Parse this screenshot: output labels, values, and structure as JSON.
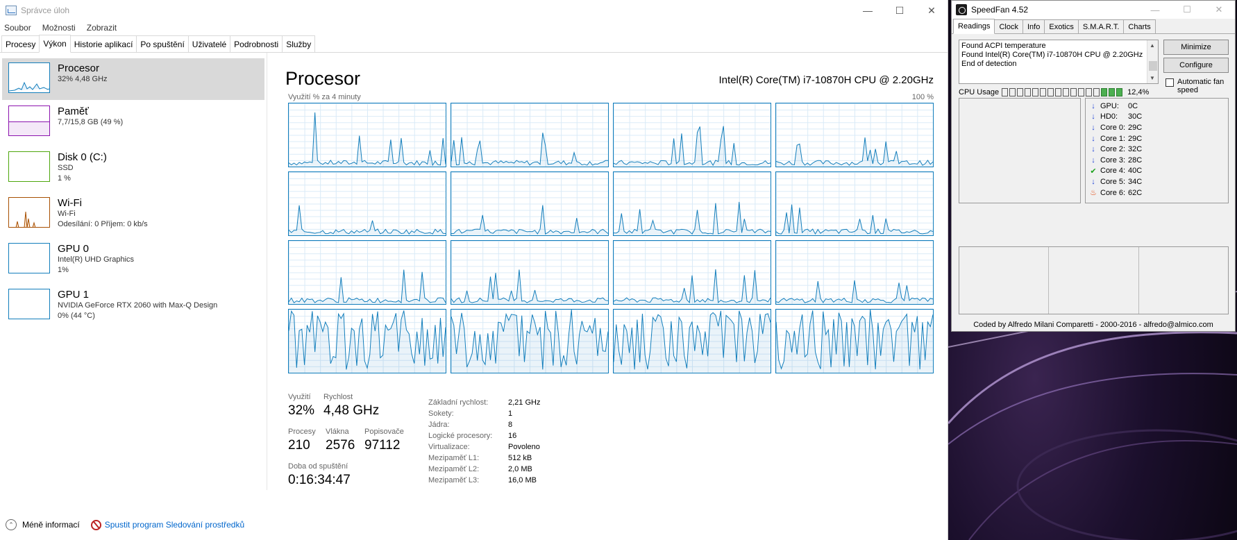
{
  "taskmanager": {
    "title": "Správce úloh",
    "menu": [
      "Soubor",
      "Možnosti",
      "Zobrazit"
    ],
    "tabs": [
      "Procesy",
      "Výkon",
      "Historie aplikací",
      "Po spuštění",
      "Uživatelé",
      "Podrobnosti",
      "Služby"
    ],
    "active_tab": "Výkon",
    "sidebar": [
      {
        "name": "Procesor",
        "sub1": "32%  4,48 GHz",
        "sub2": "",
        "sub3": "",
        "color": "#117dbb"
      },
      {
        "name": "Paměť",
        "sub1": "7,7/15,8 GB (49 %)",
        "sub2": "",
        "sub3": "",
        "color": "#8b12ae"
      },
      {
        "name": "Disk 0 (C:)",
        "sub1": "SSD",
        "sub2": "1 %",
        "sub3": "",
        "color": "#4da60c"
      },
      {
        "name": "Wi-Fi",
        "sub1": "Wi-Fi",
        "sub2": "Odesílání: 0  Příjem: 0 kb/s",
        "sub3": "",
        "color": "#a74f01"
      },
      {
        "name": "GPU 0",
        "sub1": "Intel(R) UHD Graphics",
        "sub2": "1%",
        "sub3": "",
        "color": "#117dbb"
      },
      {
        "name": "GPU 1",
        "sub1": "NVIDIA GeForce RTX 2060 with Max-Q Design",
        "sub2": "0%  (44 °C)",
        "sub3": "",
        "color": "#117dbb"
      }
    ],
    "main": {
      "title": "Procesor",
      "model": "Intel(R) Core(TM) i7-10870H CPU @ 2.20GHz",
      "util_label": "Využití % za 4 minuty",
      "util_max": "100 %",
      "stats": {
        "util_label": "Využití",
        "util_value": "32%",
        "speed_label": "Rychlost",
        "speed_value": "4,48 GHz",
        "proc_label": "Procesy",
        "proc_value": "210",
        "threads_label": "Vlákna",
        "threads_value": "2576",
        "handles_label": "Popisovače",
        "handles_value": "97112",
        "uptime_label": "Doba od spuštění",
        "uptime_value": "0:16:34:47"
      },
      "specs": [
        {
          "k": "Základní rychlost:",
          "v": "2,21 GHz"
        },
        {
          "k": "Sokety:",
          "v": "1"
        },
        {
          "k": "Jádra:",
          "v": "8"
        },
        {
          "k": "Logické procesory:",
          "v": "16"
        },
        {
          "k": "Virtualizace:",
          "v": "Povoleno"
        },
        {
          "k": "Mezipaměť L1:",
          "v": "512 kB"
        },
        {
          "k": "Mezipaměť L2:",
          "v": "2,0 MB"
        },
        {
          "k": "Mezipaměť L3:",
          "v": "16,0 MB"
        }
      ]
    },
    "footer": {
      "fewer": "Méně informací",
      "monitor_link": "Spustit program Sledování prostředků"
    },
    "accent_color": "#117dbb"
  },
  "speedfan": {
    "title": "SpeedFan 4.52",
    "tabs": [
      "Readings",
      "Clock",
      "Info",
      "Exotics",
      "S.M.A.R.T.",
      "Charts"
    ],
    "active_tab": "Readings",
    "log": [
      "Found ACPI temperature",
      "Found Intel(R) Core(TM) i7-10870H CPU @ 2.20GHz",
      "End of detection"
    ],
    "minimize_label": "Minimize",
    "configure_label": "Configure",
    "auto_fan_label": "Automatic fan speed",
    "cpu_usage_label": "CPU Usage",
    "cpu_usage_value": "12,4%",
    "cpu_bars_on": [
      13,
      14,
      15
    ],
    "cpu_bar_count": 16,
    "temps": [
      {
        "label": "GPU:",
        "value": "0C",
        "status": "down"
      },
      {
        "label": "HD0:",
        "value": "30C",
        "status": "down"
      },
      {
        "label": "Core 0:",
        "value": "29C",
        "status": "down"
      },
      {
        "label": "Core 1:",
        "value": "29C",
        "status": "down"
      },
      {
        "label": "Core 2:",
        "value": "32C",
        "status": "down"
      },
      {
        "label": "Core 3:",
        "value": "28C",
        "status": "down"
      },
      {
        "label": "Core 4:",
        "value": "40C",
        "status": "ok"
      },
      {
        "label": "Core 5:",
        "value": "34C",
        "status": "down"
      },
      {
        "label": "Core 6:",
        "value": "62C",
        "status": "fire"
      }
    ],
    "footer": "Coded by Alfredo Milani Comparetti - 2000-2016 - alfredo@almico.com"
  }
}
